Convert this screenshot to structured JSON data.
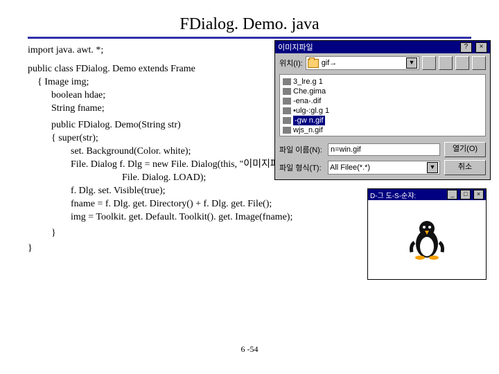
{
  "slide": {
    "title": "FDialog. Demo. java",
    "page": "6 -54"
  },
  "code": {
    "import": "import  java. awt. *;",
    "cls": "public class FDialog. Demo extends Frame",
    "l1": "{  Image   img;",
    "l2": "boolean hdae;",
    "l3": "String fname;",
    "ctor": "public  FDialog. Demo(String str)",
    "b0": "{        super(str);",
    "b1": "set. Background(Color. white);",
    "b2": "File. Dialog f. Dlg = new File. Dialog(this, \"이미지파일\",",
    "b2b": "File. Dialog. LOAD);",
    "b3": "f. Dlg. set. Visible(true);",
    "b4": "fname = f. Dlg. get. Directory() + f. Dlg. get. File();",
    "b5": "img = Toolkit. get. Default. Toolkit(). get. Image(fname);",
    "close1": "}",
    "close2": "}"
  },
  "dlg": {
    "title": "이미지파일",
    "lookin_label": "위치(I):",
    "lookin_value": "gif→",
    "files": {
      "f0": "3_lre.g 1",
      "f1": "Che.gima",
      "f2": "-ena-.dif",
      "f3": "•ulg-:gl.g 1",
      "f4": "-gw n.gif",
      "f5": "wjs_n.gif"
    },
    "fname_label": "파일 이름(N):",
    "fname_value": "n=win.gif",
    "ftype_label": "파일 형식(T):",
    "ftype_value": "All Filee(*.*)",
    "open": "열기(O)",
    "cancel": "취소"
  },
  "applet": {
    "title": "D-그 도-S-순쟈:"
  }
}
